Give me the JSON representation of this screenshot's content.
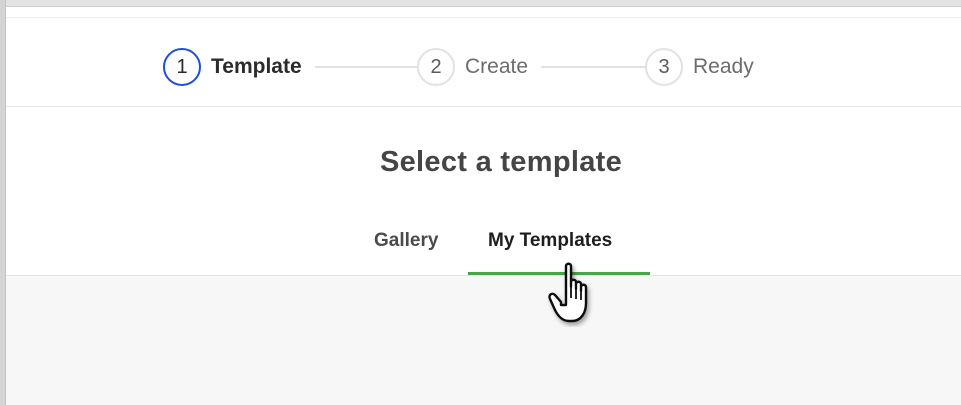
{
  "stepper": {
    "steps": [
      {
        "number": "1",
        "label": "Template",
        "active": true
      },
      {
        "number": "2",
        "label": "Create",
        "active": false
      },
      {
        "number": "3",
        "label": "Ready",
        "active": false
      }
    ]
  },
  "main": {
    "title": "Select a template",
    "tabs": [
      {
        "label": "Gallery",
        "selected": false
      },
      {
        "label": "My Templates",
        "selected": true
      }
    ]
  },
  "colors": {
    "active_step_border": "#1f4fd6",
    "selected_tab_underline": "#4aa44a",
    "content_background": "#f7f7f7"
  },
  "cursor": {
    "icon": "hand-pointer-icon"
  }
}
